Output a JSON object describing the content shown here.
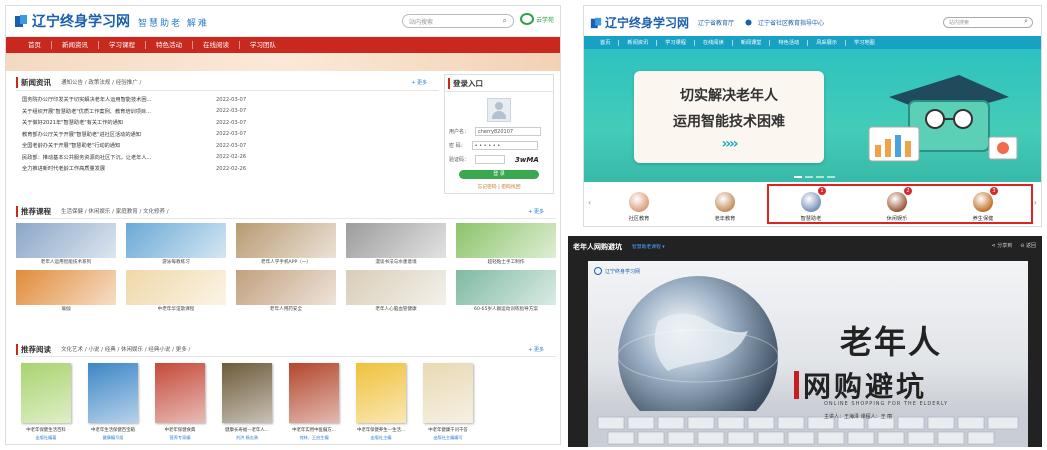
{
  "left": {
    "brand": "辽宁终身学习网",
    "slogan": "智慧助老  解难",
    "search_placeholder": "站内搜索",
    "mobile_label": "云学苑",
    "nav": [
      "首页",
      "新闻资讯",
      "学习课程",
      "特色活动",
      "在线阅读",
      "学习团队"
    ],
    "news": {
      "title": "新闻资讯",
      "tabs": "通知公告  /  政策法规  /  经验推广  /",
      "more": "+ 更多",
      "items": [
        {
          "title": "国务院办公厅印发关于切实解决老年人运用智能技术困...",
          "date": "2022-03-07"
        },
        {
          "title": "关于组织开展\"智慧助老\"优质工作案例、教育培训项目...",
          "date": "2022-03-07"
        },
        {
          "title": "关于做好2021年\"智慧助老\"有关工作的通知",
          "date": "2022-03-07"
        },
        {
          "title": "教育部办公厅关于开展\"智慧助老\"进社区活动的通知",
          "date": "2022-03-07"
        },
        {
          "title": "全国老龄办关于开展\"智慧助老\"行动的通知",
          "date": "2022-03-07"
        },
        {
          "title": "民政部：推动基本公共服务资源向社区下沉，让老年人...",
          "date": "2022-02-26"
        },
        {
          "title": "全力推进新时代老龄工作高质量发展",
          "date": "2022-02-26"
        }
      ]
    },
    "login": {
      "title": "登录入口",
      "username_label": "用户名：",
      "username_value": "cherry820107",
      "password_label": "密  码：",
      "password_value": "• • • • • •",
      "captcha_label": "验证码：",
      "captcha_value": "3wMA",
      "button": "登 录",
      "links": "忘记密码  |  密码找回"
    },
    "courses": {
      "title": "推荐课程",
      "tabs": "生活保健  /  休闲娱乐  /  家庭教育  /  文化修养  /",
      "more": "+ 更多",
      "items": [
        {
          "caption": "老年人运用智能技术系列",
          "color": "#8aa6c8"
        },
        {
          "caption": "游泳每教练习",
          "color": "#6aa9d6"
        },
        {
          "caption": "老年人学手机APP（一）",
          "color": "#b89a72"
        },
        {
          "caption": "漫谈书法与水墨意境",
          "color": "#9c9c9c"
        },
        {
          "caption": "超轻粘土手工制作",
          "color": "#8cc36a"
        },
        {
          "caption": "瑜伽",
          "color": "#e08b3a"
        },
        {
          "caption": "中老年华谊歌课程",
          "color": "#f0d8a8"
        },
        {
          "caption": "老年人用药安全",
          "color": "#c2a07e"
        },
        {
          "caption": "老年人心脑血管健康",
          "color": "#d8cdb8"
        },
        {
          "caption": "60-65岁人群运动训练指导方案",
          "color": "#7fb9a2"
        }
      ]
    },
    "reading": {
      "title": "推荐阅读",
      "tabs": "文化艺术  /  小说  /  经典  /  休闲娱乐  /  经典小说  /  更多  /",
      "more": "+ 更多",
      "items": [
        {
          "title": "中老年保健生活百科",
          "author": "出版社编著",
          "color": "#a9d36e"
        },
        {
          "title": "中老年生活保健百宝箱",
          "author": "健康编写组",
          "color": "#3d86c6"
        },
        {
          "title": "中老年保健食典",
          "author": "营养专家编",
          "color": "#c44a3a"
        },
        {
          "title": "健康长寿福—老年人...",
          "author": "刘洪  杨志勇",
          "color": "#6d5a3a"
        },
        {
          "title": "中老年实用中医偏方...",
          "author": "何林、王启生编",
          "color": "#b3462c"
        },
        {
          "title": "中老年保健养生—生活...",
          "author": "出版社主编",
          "color": "#f0c13a"
        },
        {
          "title": "中老年健康千问千答",
          "author": "出版社主编编写",
          "color": "#e9d9b3"
        }
      ]
    }
  },
  "right_top": {
    "brand": "辽宁终身学习网",
    "sub1": "辽宁省教育厅",
    "sub2": "辽宁省社区教育指导中心",
    "search_placeholder": "站内搜索",
    "nav": [
      "首页",
      "新闻资讯",
      "学习课程",
      "在线阅读",
      "新闻课堂",
      "特色活动",
      "风采展示",
      "学习地图"
    ],
    "banner_line1": "切实解决老年人",
    "banner_line2": "运用智能技术困难",
    "banner_arrows": "››››",
    "categories": [
      {
        "label": "社区教育",
        "color": "#d9a07a"
      },
      {
        "label": "老年教育",
        "color": "#c48f5e"
      },
      {
        "label": "智慧助老",
        "color": "#7a93b8",
        "badge": "1"
      },
      {
        "label": "休闲娱乐",
        "color": "#9b5a3a",
        "badge": "2"
      },
      {
        "label": "养生保健",
        "color": "#c0722c",
        "badge": "3"
      }
    ]
  },
  "right_bottom": {
    "title": "老年人网购避坑",
    "subtitle": "智慧助老课程 ▾",
    "share": "分享到",
    "back": "返回",
    "video_logo": "辽宁终身学习网",
    "headline1": "老年人",
    "headline2": "网购避坑",
    "headline_en": "ONLINE SHOPPING FOR THE ELDERLY",
    "credit": "主讲人：王海泽     课程人：王 丽"
  }
}
